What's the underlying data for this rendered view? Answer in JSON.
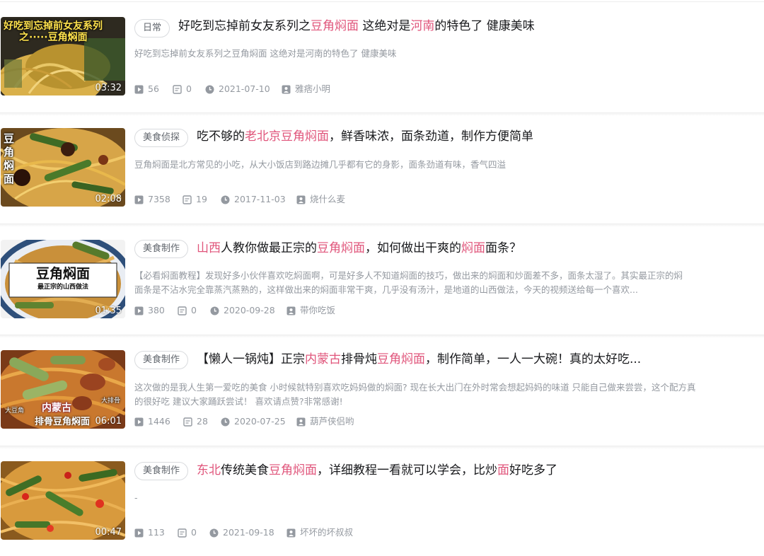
{
  "results": [
    {
      "tag": "日常",
      "title_parts": [
        "好吃到忘掉前女友系列之",
        "豆角焖面",
        " 这绝对是",
        "河南",
        "的特色了 健康美味"
      ],
      "description": [
        "好吃到忘掉前女友系列之豆角焖面 这绝对是河南的特色了 健康美味"
      ],
      "duration": "03:32",
      "thumb_text": [
        "好吃到忘掉前女友系列",
        "之·····豆角焖面"
      ],
      "plays": "56",
      "comments": "0",
      "date": "2021-07-10",
      "author": "雅痞小明"
    },
    {
      "tag": "美食侦探",
      "title_parts": [
        "吃不够的",
        "老北京豆角焖面",
        "，鲜香味浓，面条劲道，制作方便简单"
      ],
      "description": [
        "豆角焖面是北方常见的小吃，从大小饭店到路边摊几乎都有它的身影，面条劲道有味，香气四溢"
      ],
      "duration": "02:08",
      "thumb_text": [
        "豆",
        "角",
        "焖",
        "面"
      ],
      "plays": "7358",
      "comments": "19",
      "date": "2017-11-03",
      "author": "烧什么麦"
    },
    {
      "tag": "美食制作",
      "title_parts": [
        "山西",
        "人教你做最正宗的",
        "豆角焖面",
        "，如何做出干爽的",
        "焖面",
        "面条？"
      ],
      "description": [
        "【必看焖面教程】发现好多小伙伴喜欢吃焖面啊，可是好多人不知道焖面的技巧，做出来的焖面和炒面差不多，面条太湿了。其实最正宗的焖",
        "面条是不沾水完全靠蒸汽蒸熟的，这样做出来的焖面非常干爽，几乎没有汤汁，是地道的山西做法，今天的视频送给每一个喜欢..."
      ],
      "duration": "01:35",
      "thumb_text": [
        "豆角焖面",
        "最正宗的山西做法"
      ],
      "plays": "380",
      "comments": "0",
      "date": "2020-09-28",
      "author": "带你吃饭"
    },
    {
      "tag": "美食制作",
      "title_parts": [
        "【懒人一锅炖】正宗",
        "内蒙古",
        "排骨炖",
        "豆角焖面",
        "，制作简单，一人一大碗！真的太好吃..."
      ],
      "description": [
        "这次做的是我人生第一爱吃的美食 小时候就特别喜欢吃妈妈做的焖面? 现在长大出门在外时常会想起妈妈的味道 只能自己做来尝尝，这个配方真",
        "的很好吃 建议大家踊跃尝试！ 喜欢请点赞?非常感谢!"
      ],
      "duration": "06:01",
      "thumb_text": [
        "内蒙古",
        "排骨豆角焖面",
        "大豆角",
        "大排骨"
      ],
      "plays": "1446",
      "comments": "28",
      "date": "2020-07-25",
      "author": "葫芦侠侣哟"
    },
    {
      "tag": "美食制作",
      "title_parts": [
        "东北",
        "传统美食",
        "豆角焖面",
        "，详细教程一看就可以学会，比炒",
        "面",
        "好吃多了"
      ],
      "description": [
        "-"
      ],
      "duration": "00:47",
      "thumb_text": [],
      "plays": "113",
      "comments": "0",
      "date": "2021-09-18",
      "author": "坏坏的坏叔叔"
    }
  ],
  "colors": {
    "highlight": "#e0557b",
    "meta": "#9499a0",
    "title": "#18191c"
  },
  "icons": {
    "plays": "play-count-icon",
    "comments": "danmaku-icon",
    "date": "clock-icon",
    "author": "uploader-icon"
  }
}
